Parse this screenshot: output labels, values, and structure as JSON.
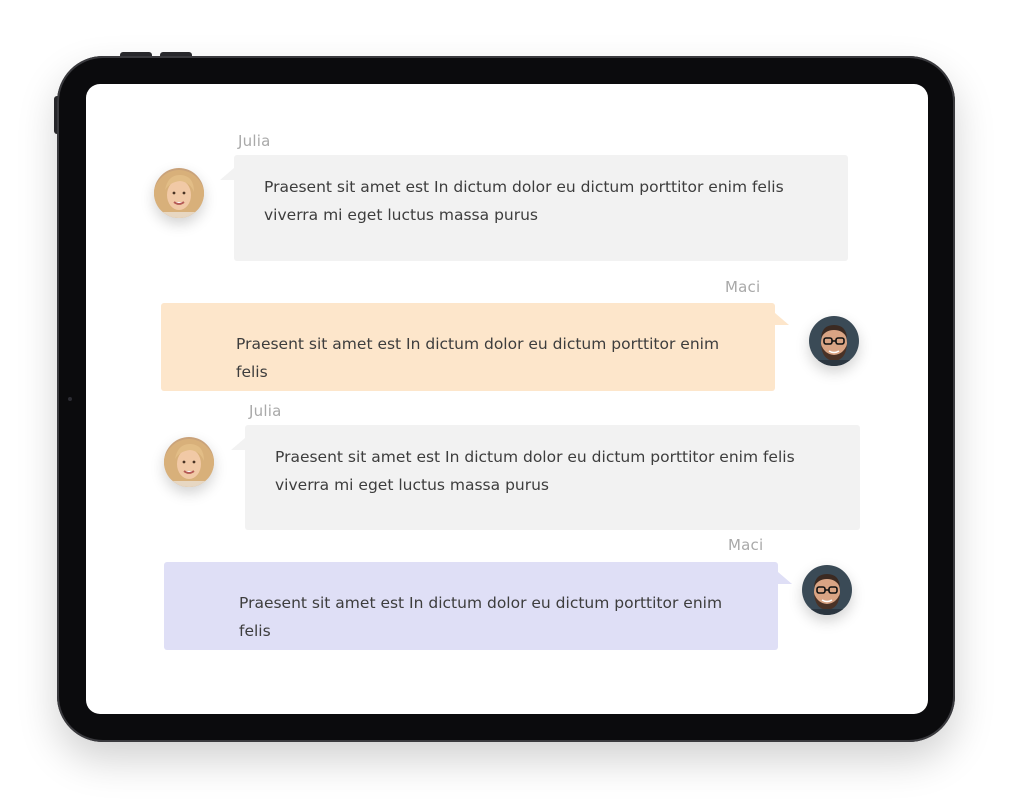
{
  "chat": {
    "messages": [
      {
        "sender": "Julia",
        "text": "Praesent sit amet est In dictum dolor eu dictum porttitor enim felis viverra mi eget luctus massa purus",
        "avatar": "woman-avatar",
        "bubble_color": "#f2f2f2"
      },
      {
        "sender": "Maci",
        "text": "Praesent sit amet est In dictum dolor eu dictum porttitor enim felis",
        "avatar": "man-avatar",
        "bubble_color": "#fde6cb"
      },
      {
        "sender": "Julia",
        "text": "Praesent sit amet est In dictum dolor eu dictum porttitor enim felis viverra mi eget luctus massa purus",
        "avatar": "woman-avatar",
        "bubble_color": "#f2f2f2"
      },
      {
        "sender": "Maci",
        "text": "Praesent sit amet est In dictum dolor eu dictum porttitor enim felis",
        "avatar": "man-avatar",
        "bubble_color": "#dfdff6"
      }
    ]
  },
  "colors": {
    "device_frame": "#0b0b0d",
    "screen": "#ffffff",
    "name_text": "#a9a9a9",
    "message_text": "#3d3d3d"
  }
}
